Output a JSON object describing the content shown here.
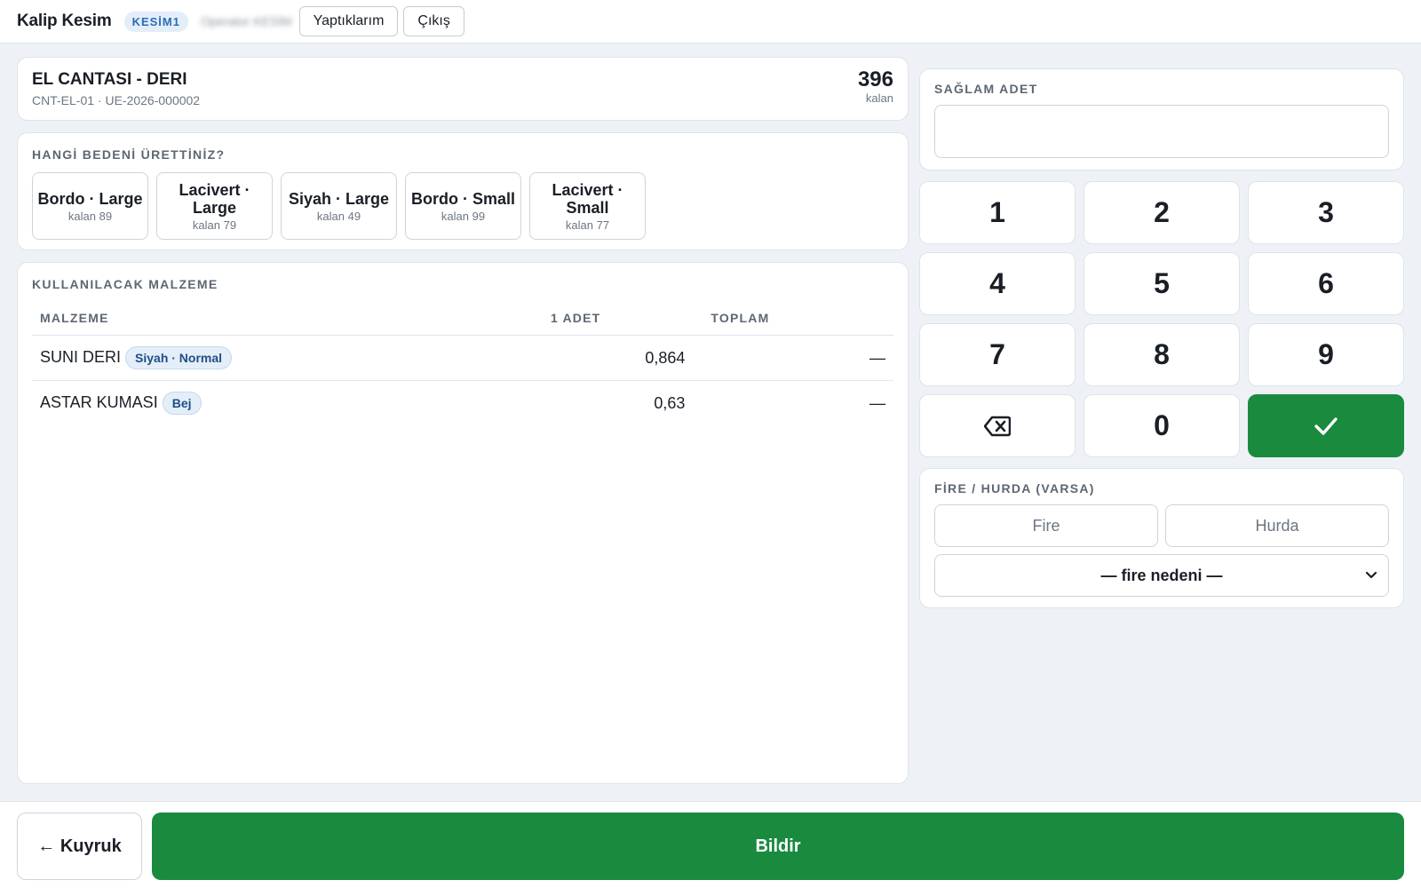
{
  "header": {
    "title": "Kalip Kesim",
    "station": "KESİM1",
    "user": "Operator KESİM",
    "my_work_label": "Yaptıklarım",
    "logout_label": "Çıkış"
  },
  "product": {
    "name": "EL CANTASI - DERI",
    "code": "CNT-EL-01 · UE-2026-000002",
    "remaining": "396",
    "remaining_label": "kalan"
  },
  "sizes": {
    "label": "HANGİ BEDENİ ÜRETTİNİZ?",
    "items": [
      {
        "name": "Bordo · Large",
        "remaining": "kalan 89"
      },
      {
        "name": "Lacivert · Large",
        "remaining": "kalan 79"
      },
      {
        "name": "Siyah · Large",
        "remaining": "kalan 49"
      },
      {
        "name": "Bordo · Small",
        "remaining": "kalan 99"
      },
      {
        "name": "Lacivert · Small",
        "remaining": "kalan 77"
      }
    ]
  },
  "materials": {
    "label": "KULLANILACAK MALZEME",
    "columns": [
      "MALZEME",
      "1 ADET",
      "TOPLAM"
    ],
    "rows": [
      {
        "name": "SUNI DERI",
        "tag": "Siyah · Normal",
        "per_unit": "0,864",
        "total": "—"
      },
      {
        "name": "ASTAR KUMASI",
        "tag": "Bej",
        "per_unit": "0,63",
        "total": "—"
      }
    ]
  },
  "quantity": {
    "label": "SAĞLAM ADET",
    "value": ""
  },
  "keypad": {
    "keys": [
      "1",
      "2",
      "3",
      "4",
      "5",
      "6",
      "7",
      "8",
      "9"
    ],
    "zero": "0"
  },
  "scrap": {
    "label": "FİRE / HURDA (VARSA)",
    "fire_placeholder": "Fire",
    "hurda_placeholder": "Hurda",
    "reason_selected": "— fire nedeni —"
  },
  "footer": {
    "back_label": "← Kuyruk",
    "submit_label": "Bildir"
  },
  "colors": {
    "accent_green": "#1a8a3f",
    "badge_blue": "#2a6cb8",
    "background": "#eef1f5"
  }
}
